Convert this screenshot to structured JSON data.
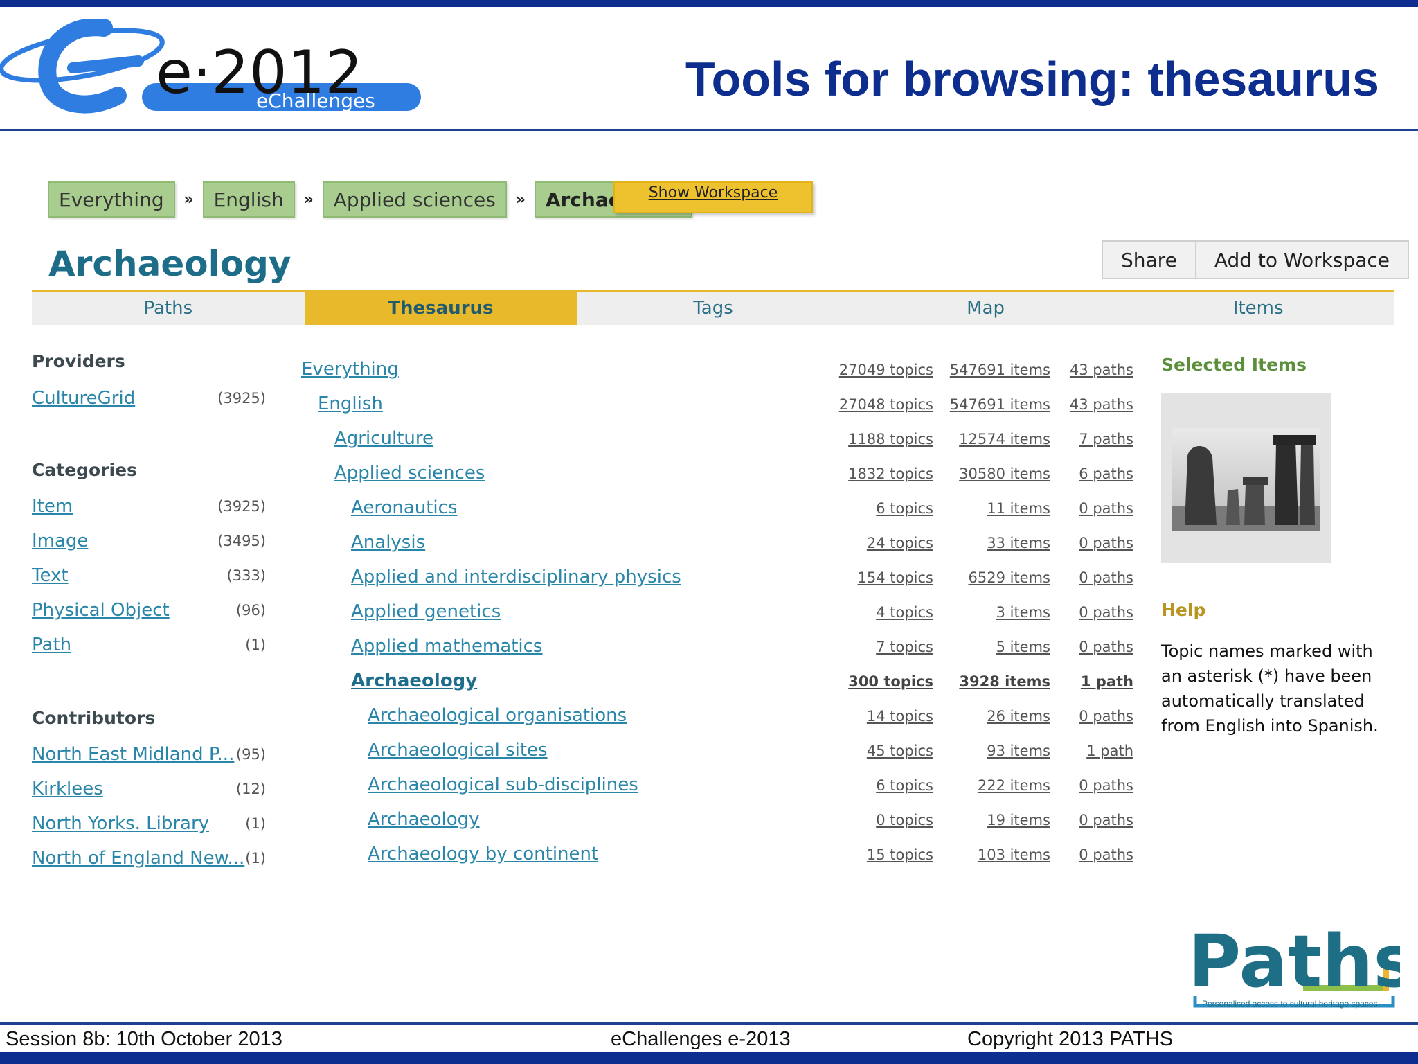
{
  "slide": {
    "logo_text": "e·2012",
    "logo_subtext": "eChallenges",
    "title": "Tools for browsing: thesaurus",
    "footer_left": "Session 8b:  10th  October 2013",
    "footer_center": "eChallenges e-2013",
    "footer_right": "Copyright 2013 PATHS",
    "brand_logo_text": "Paths",
    "brand_tagline": "Personalised access to cultural heritage spaces"
  },
  "breadcrumb": {
    "items": [
      "Everything",
      "English",
      "Applied sciences",
      "Archaeology"
    ],
    "separator": "»",
    "show_workspace_label": "Show Workspace"
  },
  "page": {
    "heading": "Archaeology",
    "share_label": "Share",
    "add_workspace_label": "Add to Workspace"
  },
  "tabs": [
    {
      "label": "Paths",
      "active": false
    },
    {
      "label": "Thesaurus",
      "active": true
    },
    {
      "label": "Tags",
      "active": false
    },
    {
      "label": "Map",
      "active": false
    },
    {
      "label": "Items",
      "active": false
    }
  ],
  "facets": {
    "providers_title": "Providers",
    "providers": [
      {
        "label": "CultureGrid",
        "count": "(3925)"
      }
    ],
    "categories_title": "Categories",
    "categories": [
      {
        "label": "Item",
        "count": "(3925)"
      },
      {
        "label": "Image",
        "count": "(3495)"
      },
      {
        "label": "Text",
        "count": "(333)"
      },
      {
        "label": "Physical Object",
        "count": "(96)"
      },
      {
        "label": "Path",
        "count": "(1)"
      }
    ],
    "contributors_title": "Contributors",
    "contributors": [
      {
        "label": "North East Midland P...",
        "count": "(95)"
      },
      {
        "label": "Kirklees",
        "count": "(12)"
      },
      {
        "label": "North Yorks. Library",
        "count": "(1)"
      },
      {
        "label": "North of England New...",
        "count": "(1)"
      }
    ]
  },
  "thesaurus": [
    {
      "name": "Everything",
      "topics": "27049 topics",
      "items": "547691 items",
      "paths": "43 paths"
    },
    {
      "name": "English",
      "topics": "27048 topics",
      "items": "547691 items",
      "paths": "43 paths"
    },
    {
      "name": "Agriculture",
      "topics": "1188 topics",
      "items": "12574 items",
      "paths": "7 paths"
    },
    {
      "name": "Applied sciences",
      "topics": "1832 topics",
      "items": "30580 items",
      "paths": "6 paths"
    },
    {
      "name": "Aeronautics",
      "topics": "6 topics",
      "items": "11 items",
      "paths": "0 paths"
    },
    {
      "name": "Analysis",
      "topics": "24 topics",
      "items": "33 items",
      "paths": "0 paths"
    },
    {
      "name": "Applied and interdisciplinary physics",
      "topics": "154 topics",
      "items": "6529 items",
      "paths": "0 paths"
    },
    {
      "name": "Applied genetics",
      "topics": "4 topics",
      "items": "3 items",
      "paths": "0 paths"
    },
    {
      "name": "Applied mathematics",
      "topics": "7 topics",
      "items": "5 items",
      "paths": "0 paths"
    },
    {
      "name": "Archaeology",
      "topics": "300 topics",
      "items": "3928 items",
      "paths": "1 path"
    },
    {
      "name": "Archaeological organisations",
      "topics": "14 topics",
      "items": "26 items",
      "paths": "0 paths"
    },
    {
      "name": "Archaeological sites",
      "topics": "45 topics",
      "items": "93 items",
      "paths": "1 path"
    },
    {
      "name": "Archaeological sub-disciplines",
      "topics": "6 topics",
      "items": "222 items",
      "paths": "0 paths"
    },
    {
      "name": "Archaeology",
      "topics": "0 topics",
      "items": "19 items",
      "paths": "0 paths"
    },
    {
      "name": "Archaeology by continent",
      "topics": "15 topics",
      "items": "103 items",
      "paths": "0 paths"
    }
  ],
  "side": {
    "selected_title": "Selected Items",
    "help_title": "Help",
    "help_text": "Topic names marked with an asterisk (*) have been automatically translated from English into Spanish."
  },
  "colors": {
    "brand_blue": "#0d2e8f",
    "crumb_green": "#a9cd8f",
    "tab_gold": "#e7b92b",
    "link_teal": "#2a86a8"
  }
}
